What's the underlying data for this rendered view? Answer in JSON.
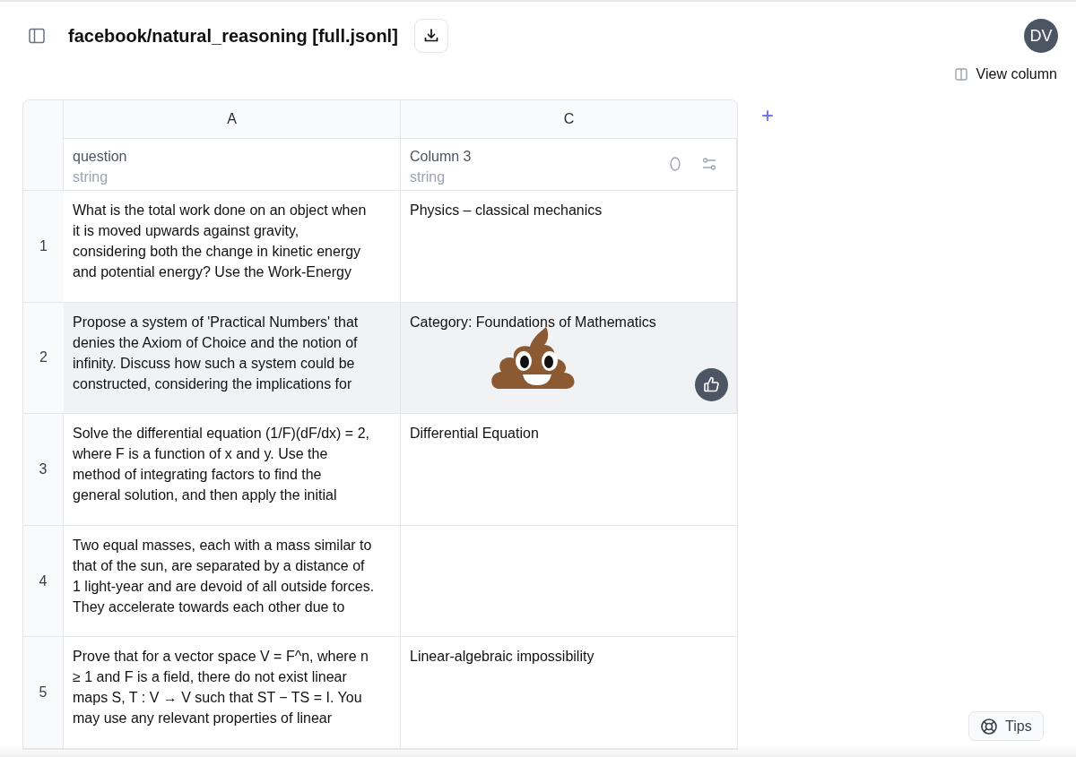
{
  "header": {
    "title": "facebook/natural_reasoning [full.jsonl]",
    "avatar": "DV",
    "view_column": "View column"
  },
  "table": {
    "columns": [
      {
        "letter": "A",
        "name": "question",
        "type": "string",
        "tools": false
      },
      {
        "letter": "C",
        "name": "Column 3",
        "type": "string",
        "tools": true
      }
    ],
    "add_column": "+",
    "rows": [
      {
        "index": "1",
        "hovered": false,
        "cells": [
          "What is the total work done on an object when\nit is moved upwards against gravity,\nconsidering both the change in kinetic energy\nand potential energy? Use the Work-Energy",
          "Physics – classical mechanics"
        ]
      },
      {
        "index": "2",
        "hovered": true,
        "cells": [
          "Propose a system of 'Practical Numbers' that\ndenies the Axiom of Choice and the notion of\ninfinity. Discuss how such a system could be\nconstructed, considering the implications for",
          "Category: Foundations of Mathematics"
        ]
      },
      {
        "index": "3",
        "hovered": false,
        "cells": [
          "Solve the differential equation (1/F)(dF/dx) = 2,\nwhere F is a function of x and y. Use the\nmethod of integrating factors to find the\ngeneral solution, and then apply the initial",
          "Differential Equation"
        ]
      },
      {
        "index": "4",
        "hovered": false,
        "cells": [
          "Two equal masses, each with a mass similar to\nthat of the sun, are separated by a distance of\n1 light-year and are devoid of all outside forces.\nThey accelerate towards each other due to",
          ""
        ]
      },
      {
        "index": "5",
        "hovered": false,
        "cells": [
          "Prove that for a vector space V = F^n, where n\n≥ 1 and F is a field, there do not exist linear\nmaps S, T : V → V such that ST − TS = I. You\nmay use any relevant properties of linear",
          "Linear-algebraic impossibility"
        ]
      }
    ]
  },
  "tips": "Tips"
}
